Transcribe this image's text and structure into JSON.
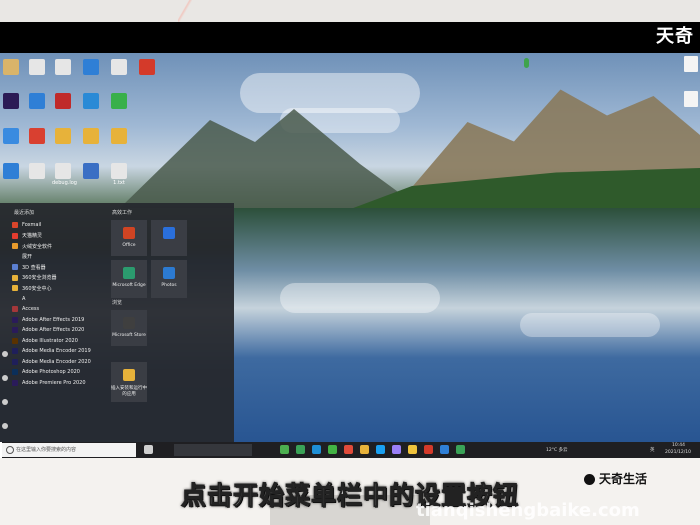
{
  "watermark_top": "天奇",
  "desktop": {
    "icons": [
      {
        "label": "",
        "color": "#d9b46a"
      },
      {
        "label": "",
        "color": "#e6e6e6"
      },
      {
        "label": "",
        "color": "#e6e6e6"
      },
      {
        "label": "",
        "color": "#2f7fd6"
      },
      {
        "label": "",
        "color": "#e6e6e6"
      },
      {
        "label": "",
        "color": "#d43a2a"
      },
      {
        "label": "",
        "color": "#2b1a55"
      },
      {
        "label": "",
        "color": "#2f7fd6"
      },
      {
        "label": "",
        "color": "#c02a2a"
      },
      {
        "label": "",
        "color": "#2a8ad6"
      },
      {
        "label": "",
        "color": "#38b04a"
      },
      {
        "label": "",
        "color": "#3a8be0"
      },
      {
        "label": "",
        "color": "#d94030"
      },
      {
        "label": "",
        "color": "#e7b23a"
      },
      {
        "label": "",
        "color": "#e7b23a"
      },
      {
        "label": "",
        "color": "#e7b23a"
      },
      {
        "label": "",
        "color": "#2f7fd6"
      },
      {
        "label": "",
        "color": "#e6e6e6"
      },
      {
        "label": "debug.log",
        "color": "#e6e6e6"
      },
      {
        "label": "",
        "color": "#3a6fc4"
      },
      {
        "label": "1.txt",
        "color": "#e6e6e6"
      }
    ]
  },
  "start_menu": {
    "recent_header": "最近添加",
    "expand_label": "展开",
    "tiles_header": "高效工作",
    "browse_header": "浏览",
    "apps": [
      {
        "label": "Foxmail",
        "icon": "foxmail-icon",
        "color": "#d9452b"
      },
      {
        "label": "天猫精灵",
        "icon": "tmall-icon",
        "color": "#e33c2f"
      },
      {
        "label": "火绒安全软件",
        "icon": "huorong-icon",
        "color": "#e89b2c"
      },
      {
        "label": "展开",
        "icon": "expand-icon",
        "color": ""
      },
      {
        "label": "3D 查看器",
        "icon": "3d-viewer-icon",
        "color": "#5b7fd1"
      },
      {
        "label": "360安全浏览器",
        "icon": "folder-icon",
        "color": "#e7b23a"
      },
      {
        "label": "360安全中心",
        "icon": "folder-icon",
        "color": "#e7b23a"
      },
      {
        "label": "A",
        "icon": "",
        "color": ""
      },
      {
        "label": "Access",
        "icon": "access-icon",
        "color": "#a4373a"
      },
      {
        "label": "Adobe After Effects 2019",
        "icon": "ae-icon",
        "color": "#2a1b5a"
      },
      {
        "label": "Adobe After Effects 2020",
        "icon": "ae-icon",
        "color": "#2a1b5a"
      },
      {
        "label": "Adobe Illustrator 2020",
        "icon": "ai-icon",
        "color": "#5a3200"
      },
      {
        "label": "Adobe Media Encoder 2019",
        "icon": "me-icon",
        "color": "#1f1f5a"
      },
      {
        "label": "Adobe Media Encoder 2020",
        "icon": "me-icon",
        "color": "#1f1f5a"
      },
      {
        "label": "Adobe Photoshop 2020",
        "icon": "ps-icon",
        "color": "#0b2f5a"
      },
      {
        "label": "Adobe Premiere Pro 2020",
        "icon": "pr-icon",
        "color": "#2a1b5a"
      }
    ],
    "tiles": [
      {
        "label": "Office",
        "icon": "office-icon",
        "color": "#d04423"
      },
      {
        "label": "",
        "icon": "mail-icon",
        "color": "#2a6fdb"
      },
      {
        "label": "Microsoft Edge",
        "icon": "edge-icon",
        "color": "#2b9b6e"
      },
      {
        "label": "Photos",
        "icon": "photos-icon",
        "color": "#2c7ad1"
      },
      {
        "label": "Microsoft Store",
        "icon": "store-icon",
        "color": "#3f3f3f"
      },
      {
        "label": "插入安装和运行中的应用",
        "icon": "app-icon",
        "color": "#e7b23a"
      }
    ]
  },
  "taskbar": {
    "search_placeholder": "在这里输入你要搜索的内容",
    "weather": "12°C 多云",
    "lang": "英",
    "time": "10:44",
    "date": "2021/12/10",
    "icons": [
      {
        "name": "task-view-icon",
        "color": "#cfcfcf"
      },
      {
        "name": "chrome-icon",
        "color": "#4caf50"
      },
      {
        "name": "360-browser-icon",
        "color": "#3aa357"
      },
      {
        "name": "edge-icon",
        "color": "#1e8fd6"
      },
      {
        "name": "wechat-icon",
        "color": "#43b344"
      },
      {
        "name": "wps-icon",
        "color": "#e04b3a"
      },
      {
        "name": "app-icon",
        "color": "#e7b23a"
      },
      {
        "name": "photoshop-icon",
        "color": "#1aa0f0"
      },
      {
        "name": "premiere-icon",
        "color": "#9a7ff6"
      },
      {
        "name": "folder-icon",
        "color": "#f0c33c"
      },
      {
        "name": "app-icon",
        "color": "#d43a2a"
      },
      {
        "name": "app-icon",
        "color": "#2f7fd6"
      },
      {
        "name": "app-icon",
        "color": "#3aa357"
      }
    ]
  },
  "subtitle": "点击开始菜单栏中的设置按钮",
  "brand": "天奇生活",
  "site": "tianqishengbaike.com"
}
